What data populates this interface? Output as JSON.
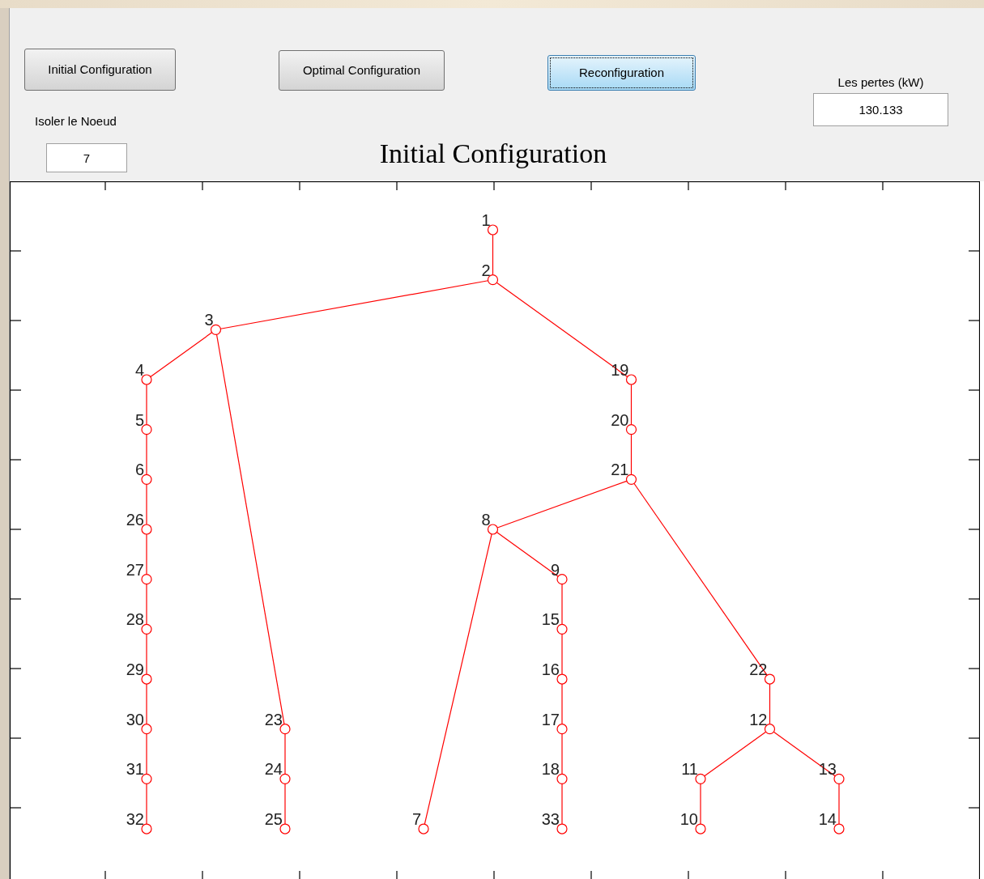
{
  "buttons": [
    {
      "label": "Initial Configuration",
      "focused": false
    },
    {
      "label": "Optimal Configuration",
      "focused": false
    },
    {
      "label": "Reconfiguration",
      "focused": true
    }
  ],
  "isolate_node": {
    "label": "Isoler le Noeud",
    "value": "7"
  },
  "losses": {
    "label": "Les pertes (kW)",
    "value": "130.133"
  },
  "plot": {
    "title": "Initial Configuration",
    "tree": {
      "label": "1",
      "children": [
        {
          "label": "2",
          "children": [
            {
              "label": "3",
              "children": [
                {
                  "label": "4",
                  "children": [
                    {
                      "label": "5",
                      "children": [
                        {
                          "label": "6",
                          "children": [
                            {
                              "label": "26",
                              "children": [
                                {
                                  "label": "27",
                                  "children": [
                                    {
                                      "label": "28",
                                      "children": [
                                        {
                                          "label": "29",
                                          "children": [
                                            {
                                              "label": "30",
                                              "children": [
                                                {
                                                  "label": "31",
                                                  "children": [
                                                    {
                                                      "label": "32"
                                                    }
                                                  ]
                                                }
                                              ]
                                            }
                                          ]
                                        }
                                      ]
                                    }
                                  ]
                                }
                              ]
                            }
                          ]
                        }
                      ]
                    }
                  ]
                },
                {
                  "label": "23",
                  "children": [
                    {
                      "label": "24",
                      "children": [
                        {
                          "label": "25"
                        }
                      ]
                    }
                  ]
                }
              ]
            },
            {
              "label": "19",
              "children": [
                {
                  "label": "20",
                  "children": [
                    {
                      "label": "21",
                      "children": [
                        {
                          "label": "8",
                          "children": [
                            {
                              "label": "7"
                            },
                            {
                              "label": "9",
                              "children": [
                                {
                                  "label": "15",
                                  "children": [
                                    {
                                      "label": "16",
                                      "children": [
                                        {
                                          "label": "17",
                                          "children": [
                                            {
                                              "label": "18",
                                              "children": [
                                                {
                                                  "label": "33"
                                                }
                                              ]
                                            }
                                          ]
                                        }
                                      ]
                                    }
                                  ]
                                }
                              ]
                            }
                          ]
                        },
                        {
                          "label": "22",
                          "children": [
                            {
                              "label": "12",
                              "children": [
                                {
                                  "label": "11",
                                  "children": [
                                    {
                                      "label": "10"
                                    }
                                  ]
                                },
                                {
                                  "label": "13",
                                  "children": [
                                    {
                                      "label": "14"
                                    }
                                  ]
                                }
                              ]
                            }
                          ]
                        }
                      ]
                    }
                  ]
                }
              ]
            }
          ]
        }
      ]
    }
  }
}
